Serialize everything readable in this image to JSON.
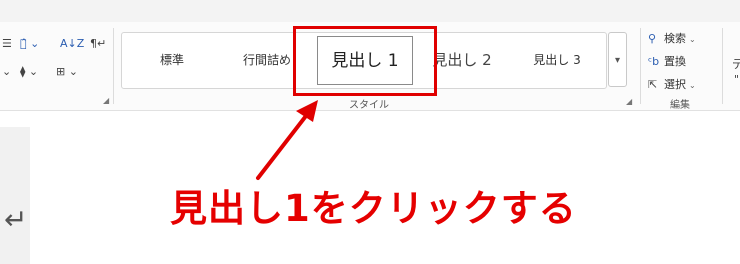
{
  "ribbon": {
    "paragraph_tools": {
      "row1": [
        "☰",
        "文̂ ⌄",
        "A↓Z",
        "¶↵"
      ],
      "row2": [
        "⌄",
        "⧫ ⌄",
        "⊞ ⌄"
      ]
    },
    "styles_group": {
      "label": "スタイル",
      "items": [
        {
          "label": "標準"
        },
        {
          "label": "行間詰め"
        },
        {
          "label": "見出し 1",
          "selected": true
        },
        {
          "label": "見出し 2"
        },
        {
          "label": "見出し 3"
        }
      ],
      "scroll_glyph": "▾"
    },
    "editing_group": {
      "label": "編集",
      "search": "検索",
      "replace": "置換",
      "select": "選択"
    },
    "cut_off_char_top": "デ",
    "cut_off_char_bottom": "\""
  },
  "document": {
    "return_mark": "↵"
  },
  "annotation": {
    "caption": "見出し1をクリックする",
    "color": "#e50000"
  }
}
